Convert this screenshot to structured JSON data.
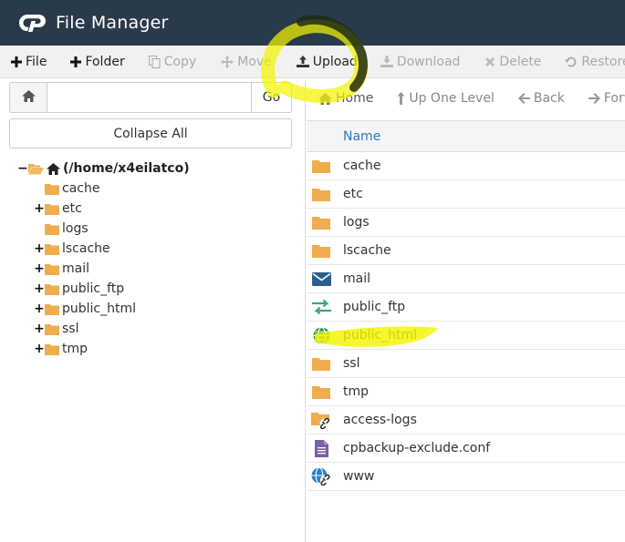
{
  "header": {
    "title": "File Manager"
  },
  "toolbar": {
    "items": [
      {
        "label": "File",
        "icon": "plus-icon",
        "state": "active"
      },
      {
        "label": "Folder",
        "icon": "plus-icon",
        "state": "active"
      },
      {
        "label": "Copy",
        "icon": "copy-icon",
        "state": "disabled"
      },
      {
        "label": "Move",
        "icon": "move-icon",
        "state": "disabled"
      },
      {
        "label": "Upload",
        "icon": "upload-icon",
        "state": "active"
      },
      {
        "label": "Download",
        "icon": "download-icon",
        "state": "disabled"
      },
      {
        "label": "Delete",
        "icon": "delete-icon",
        "state": "disabled"
      },
      {
        "label": "Restore",
        "icon": "restore-icon",
        "state": "disabled"
      }
    ]
  },
  "left": {
    "path_value": "",
    "go_label": "Go",
    "collapse_label": "Collapse All",
    "tree": {
      "root": "(/home/x4eilatco)",
      "items": [
        {
          "label": "cache",
          "expandable": false
        },
        {
          "label": "etc",
          "expandable": true
        },
        {
          "label": "logs",
          "expandable": false
        },
        {
          "label": "lscache",
          "expandable": true
        },
        {
          "label": "mail",
          "expandable": true
        },
        {
          "label": "public_ftp",
          "expandable": true
        },
        {
          "label": "public_html",
          "expandable": true
        },
        {
          "label": "ssl",
          "expandable": true
        },
        {
          "label": "tmp",
          "expandable": true
        }
      ]
    }
  },
  "nav": {
    "home": "Home",
    "up": "Up One Level",
    "back": "Back",
    "forward": "Forwa"
  },
  "list": {
    "column_name": "Name",
    "rows": [
      {
        "name": "cache",
        "icon": "folder-icon"
      },
      {
        "name": "etc",
        "icon": "folder-icon"
      },
      {
        "name": "logs",
        "icon": "folder-icon"
      },
      {
        "name": "lscache",
        "icon": "folder-icon"
      },
      {
        "name": "mail",
        "icon": "mail-icon"
      },
      {
        "name": "public_ftp",
        "icon": "ftp-icon"
      },
      {
        "name": "public_html",
        "icon": "globe-icon"
      },
      {
        "name": "ssl",
        "icon": "folder-icon"
      },
      {
        "name": "tmp",
        "icon": "folder-icon"
      },
      {
        "name": "access-logs",
        "icon": "folder-link-icon"
      },
      {
        "name": "cpbackup-exclude.conf",
        "icon": "file-icon"
      },
      {
        "name": "www",
        "icon": "globe-link-icon"
      }
    ]
  },
  "colors": {
    "header_bg": "#293a4a",
    "folder": "#f0ad4e",
    "link_blue": "#2e78b8",
    "highlight": "#ffff00"
  }
}
